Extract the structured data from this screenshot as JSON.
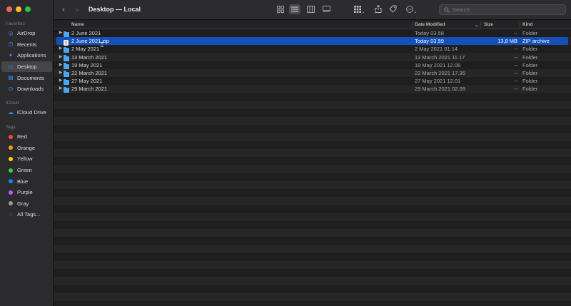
{
  "window": {
    "title": "Desktop — Local"
  },
  "sidebar": {
    "favorites_heading": "Favorites",
    "favorites": [
      {
        "label": "AirDrop",
        "icon": "airdrop-icon",
        "active": false
      },
      {
        "label": "Recents",
        "icon": "clock-icon",
        "active": false
      },
      {
        "label": "Applications",
        "icon": "applications-icon",
        "active": false
      },
      {
        "label": "Desktop",
        "icon": "desktop-icon",
        "active": true
      },
      {
        "label": "Documents",
        "icon": "document-icon",
        "active": false
      },
      {
        "label": "Downloads",
        "icon": "download-icon",
        "active": false
      }
    ],
    "icloud_heading": "iCloud",
    "icloud": [
      {
        "label": "iCloud Drive",
        "icon": "cloud-icon"
      }
    ],
    "tags_heading": "Tags",
    "tags": [
      {
        "label": "Red",
        "color": "#ff453a"
      },
      {
        "label": "Orange",
        "color": "#ff9f0a"
      },
      {
        "label": "Yellow",
        "color": "#ffd60a"
      },
      {
        "label": "Green",
        "color": "#32d74b"
      },
      {
        "label": "Blue",
        "color": "#0a84ff"
      },
      {
        "label": "Purple",
        "color": "#bf5af2"
      },
      {
        "label": "Gray",
        "color": "#98989d"
      },
      {
        "label": "All Tags...",
        "color": ""
      }
    ]
  },
  "toolbar": {
    "search_placeholder": "Search"
  },
  "columns": {
    "name": "Name",
    "date_modified": "Date Modified",
    "size": "Size",
    "kind": "Kind"
  },
  "files": [
    {
      "name": "2 June 2021",
      "date": "Today 03.58",
      "size": "--",
      "kind": "Folder",
      "type": "folder",
      "selected": false
    },
    {
      "name": "2 June 2021.zip",
      "date": "Today 03.59",
      "size": "13,8 MB",
      "kind": "ZIP archive",
      "type": "zip",
      "selected": true
    },
    {
      "name": "2 May 2021",
      "date": "2 May 2021 01.14",
      "size": "--",
      "kind": "Folder",
      "type": "folder",
      "selected": false
    },
    {
      "name": "13 March 2021",
      "date": "13 March 2021 11.17",
      "size": "--",
      "kind": "Folder",
      "type": "folder",
      "selected": false
    },
    {
      "name": "19 May 2021",
      "date": "19 May 2021 12.06",
      "size": "--",
      "kind": "Folder",
      "type": "folder",
      "selected": false
    },
    {
      "name": "22 March 2021",
      "date": "22 March 2021 17.35",
      "size": "--",
      "kind": "Folder",
      "type": "folder",
      "selected": false
    },
    {
      "name": "27 May 2021",
      "date": "27 May 2021 12.01",
      "size": "--",
      "kind": "Folder",
      "type": "folder",
      "selected": false
    },
    {
      "name": "29 March 2021",
      "date": "29 March 2021 02.09",
      "size": "--",
      "kind": "Folder",
      "type": "folder",
      "selected": false
    }
  ],
  "colors": {
    "accent": "#1450b8",
    "folder": "#4aa7ee",
    "sidebar_icon": "#3a8ef6"
  }
}
